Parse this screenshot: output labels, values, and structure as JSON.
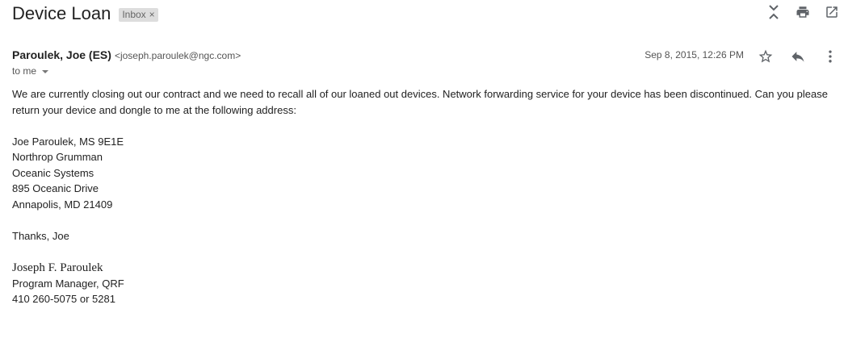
{
  "subject": "Device Loan",
  "label": "Inbox",
  "top_icons": [
    "collapse-all-icon",
    "print-icon",
    "open-in-new-window-icon"
  ],
  "message": {
    "sender_name": "Paroulek, Joe (ES)",
    "sender_email": "<joseph.paroulek@ngc.com>",
    "date": "Sep 8, 2015, 12:26 PM",
    "to": "to me",
    "icons": [
      "star-icon",
      "reply-icon",
      "more-vert-icon"
    ],
    "body": {
      "paragraph": "We are currently closing out our contract and we need to recall all of our loaned out devices.  Network forwarding service for your device has been discontinued.  Can you please return your device and dongle to me at the following address:",
      "address": [
        "Joe Paroulek, MS 9E1E",
        "Northrop Grumman",
        "Oceanic Systems",
        "895 Oceanic Drive",
        "Annapolis, MD 21409"
      ],
      "closing": "Thanks, Joe",
      "signature": {
        "name": "Joseph F. Paroulek",
        "title": "Program Manager, QRF",
        "phone": "410 260-5075 or 5281"
      }
    }
  }
}
